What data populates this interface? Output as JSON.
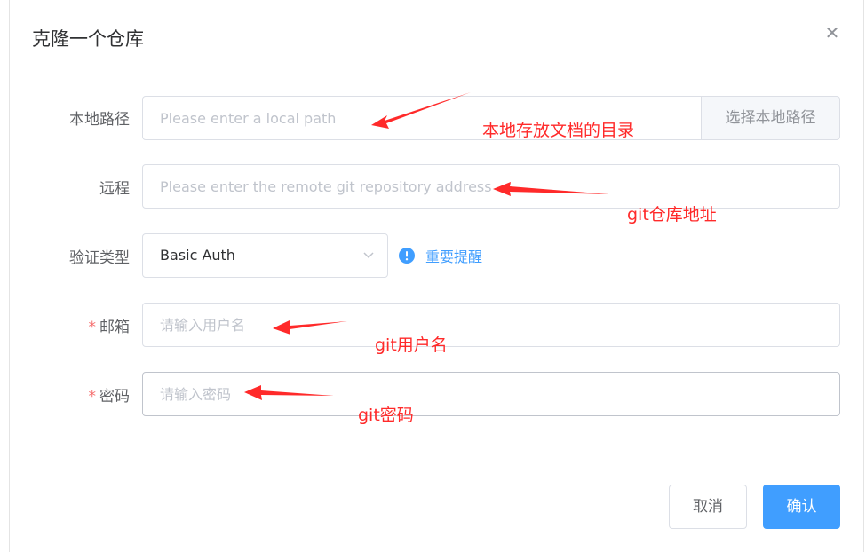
{
  "dialog": {
    "title": "克隆一个仓库",
    "close_icon": "close-icon"
  },
  "form": {
    "local_path": {
      "label": "本地路径",
      "placeholder": "Please enter a local path",
      "append_button": "选择本地路径"
    },
    "remote": {
      "label": "远程",
      "placeholder": "Please enter the remote git repository address"
    },
    "auth": {
      "label": "验证类型",
      "selected": "Basic Auth",
      "tip_icon": "exclamation-circle-icon",
      "tip_text": "重要提醒"
    },
    "email": {
      "required_mark": "*",
      "label": "邮箱",
      "placeholder": "请输入用户名"
    },
    "password": {
      "required_mark": "*",
      "label": "密码",
      "placeholder": "请输入密码"
    }
  },
  "footer": {
    "cancel": "取消",
    "confirm": "确认"
  },
  "annotations": {
    "local_path": "本地存放文档的目录",
    "remote": "git仓库地址",
    "email": "git用户名",
    "password": "git密码",
    "color": "#ff2a2a"
  },
  "colors": {
    "primary": "#409eff",
    "required": "#f56c6c"
  }
}
